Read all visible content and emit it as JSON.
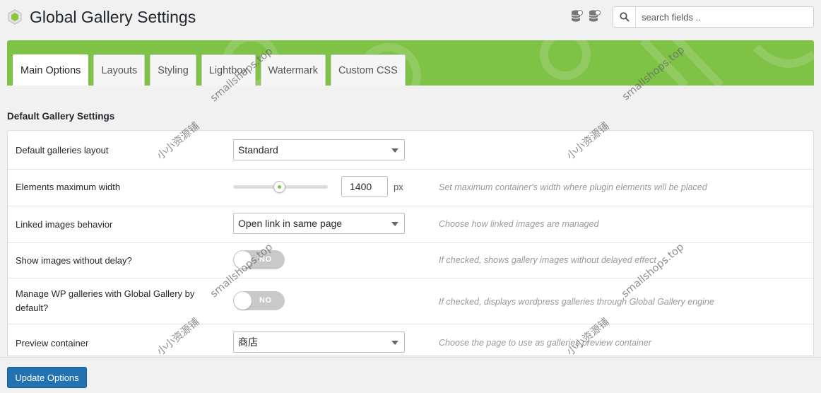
{
  "header": {
    "title": "Global Gallery Settings",
    "icons": [
      "database-export-icon",
      "database-import-icon"
    ]
  },
  "search": {
    "placeholder": "search fields .."
  },
  "tabs": [
    {
      "label": "Main Options",
      "active": true
    },
    {
      "label": "Layouts"
    },
    {
      "label": "Styling"
    },
    {
      "label": "Lightbox"
    },
    {
      "label": "Watermark"
    },
    {
      "label": "Custom CSS"
    }
  ],
  "section": {
    "title": "Default Gallery Settings"
  },
  "rows": [
    {
      "label": "Default galleries layout",
      "value": "Standard",
      "help": ""
    },
    {
      "label": "Elements maximum width",
      "value": "1400",
      "unit": "px",
      "slider_fraction": 0.49,
      "help": "Set maximum container's width where plugin elements will be placed"
    },
    {
      "label": "Linked images behavior",
      "value": "Open link in same page",
      "help": "Choose how linked images are managed"
    },
    {
      "label": "Show images without delay?",
      "value": "NO",
      "help": "If checked, shows gallery images without delayed effect"
    },
    {
      "label": "Manage WP galleries with Global Gallery by default?",
      "value": "NO",
      "help": "If checked, displays wordpress galleries through Global Gallery engine"
    },
    {
      "label": "Preview container",
      "value": "商店",
      "help": "Choose the page to use as galleries preview container"
    }
  ],
  "footer": {
    "update_label": "Update Options"
  },
  "watermarks": [
    "smallshops.top",
    "小小资源铺"
  ],
  "colors": {
    "accent_green": "#7ec246",
    "button_blue": "#2271b1"
  }
}
